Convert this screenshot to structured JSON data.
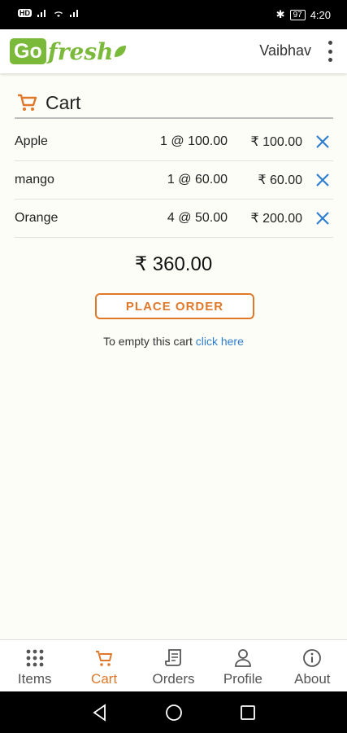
{
  "status_bar": {
    "left_badge": "HD",
    "time": "4:20",
    "battery": "97"
  },
  "app_bar": {
    "logo_go": "Go",
    "logo_fresh": "fresh",
    "user_name": "Vaibhav",
    "menu_icon": "kebab-menu-icon"
  },
  "cart": {
    "title": "Cart",
    "items": [
      {
        "name": "Apple",
        "qty_price": "1 @ 100.00",
        "total": "₹ 100.00"
      },
      {
        "name": "mango",
        "qty_price": "1 @ 60.00",
        "total": "₹ 60.00"
      },
      {
        "name": "Orange",
        "qty_price": "4 @ 50.00",
        "total": "₹ 200.00"
      }
    ],
    "grand_total": "₹ 360.00",
    "place_order_label": "PLACE ORDER",
    "empty_text": "To empty this cart",
    "empty_link": "click here"
  },
  "bottom_nav": [
    {
      "label": "Items",
      "icon": "grid-icon",
      "active": false
    },
    {
      "label": "Cart",
      "icon": "cart-icon",
      "active": true
    },
    {
      "label": "Orders",
      "icon": "receipt-icon",
      "active": false
    },
    {
      "label": "Profile",
      "icon": "person-icon",
      "active": false
    },
    {
      "label": "About",
      "icon": "info-icon",
      "active": false
    }
  ],
  "colors": {
    "accent": "#e0782a",
    "brand_green": "#7ab93a",
    "link_blue": "#2f7fd1"
  }
}
